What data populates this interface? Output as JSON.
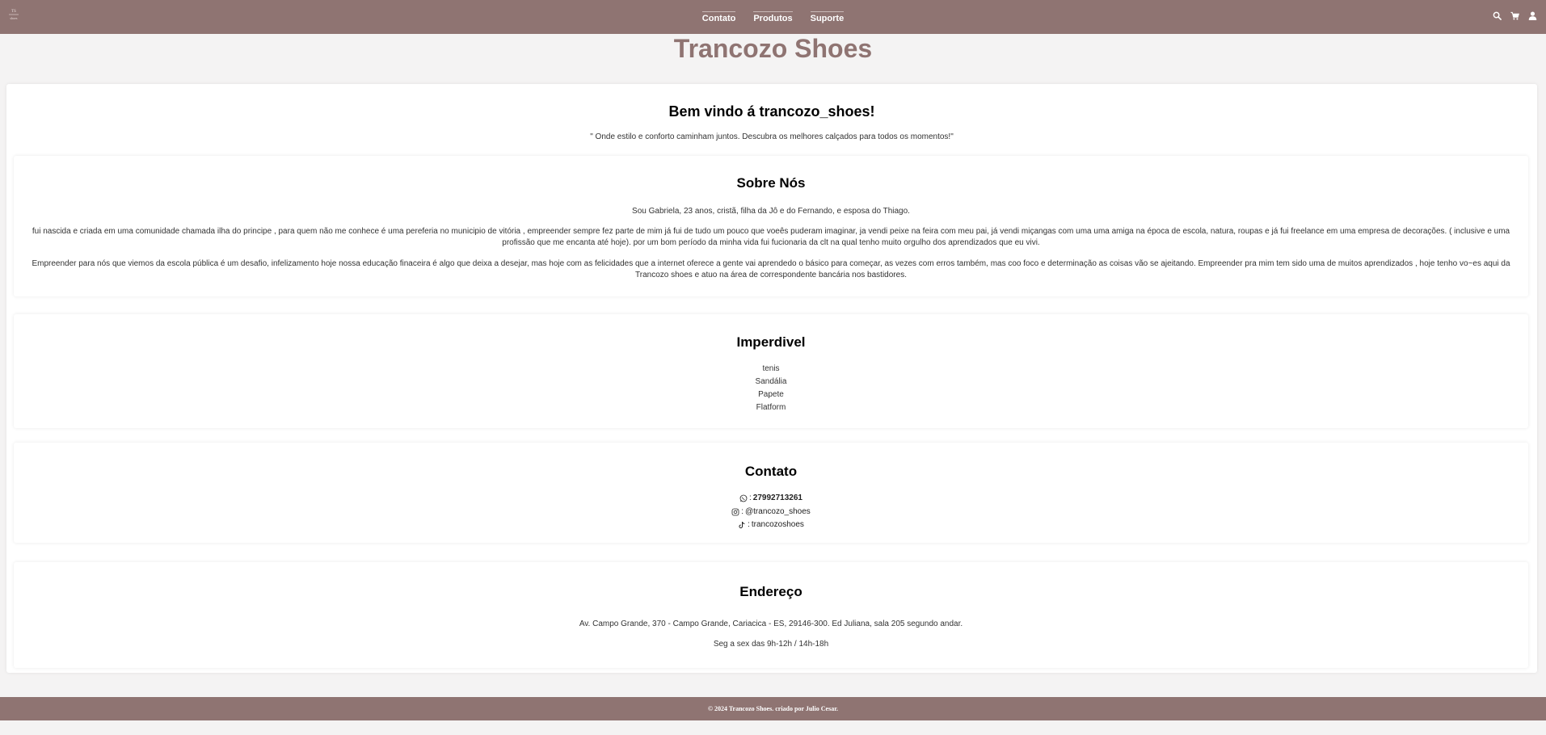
{
  "header": {
    "logo_text": "",
    "nav": [
      {
        "label": "Contato"
      },
      {
        "label": "Produtos"
      },
      {
        "label": "Suporte"
      }
    ],
    "icons": [
      "search-icon",
      "cart-icon",
      "user-icon"
    ]
  },
  "site_title": "Trancozo Shoes",
  "welcome": {
    "title": "Bem vindo á trancozo_shoes!",
    "subtitle": "\" Onde estilo e conforto caminham juntos. Descubra os melhores calçados para todos os momentos!\""
  },
  "about": {
    "title": "Sobre Nós",
    "p1": "Sou Gabriela, 23 anos, cristã, filha da Jô e do Fernando, e esposa do Thiago.",
    "p2": "fui nascida e criada em uma comunidade chamada ilha do principe , para quem não me conhece é uma pereferia no municipio de vitória , empreender sempre fez parte de mim já fui de tudo um pouco que voeês puderam imaginar, ja vendi peixe na feira com meu pai, já vendi miçangas com uma uma amiga na época de escola, natura, roupas e já fui freelance em uma empresa de decorações. ( inclusive e uma profissão que me encanta até hoje). por um bom período da minha vida fui fucionaria da clt na qual tenho muito orgulho dos aprendizados que eu vivi.",
    "p3": "Empreender para nós que viemos da escola pública é um desafio, infelizamento hoje nossa educação finaceira é algo que deixa a desejar, mas hoje com as felicidades que a internet oferece a gente vai aprendedo o básico para começar, as vezes com erros também, mas coo foco e determinação as coisas vão se ajeitando. Empreender pra mim tem sido uma de muitos aprendizados , hoje tenho vo~es aqui da Trancozo shoes e atuo na área de correspondente bancária nos bastidores."
  },
  "featured": {
    "title": "Imperdivel",
    "items": [
      "tenis",
      "Sandália",
      "Papete",
      "Flatform"
    ]
  },
  "contact": {
    "title": "Contato",
    "whatsapp": "27992713261",
    "instagram": "@trancozo_shoes",
    "tiktok": "trancozoshoes",
    "sep": ":"
  },
  "address": {
    "title": "Endereço",
    "line": "Av. Campo Grande, 370 - Campo Grande, Cariacica - ES, 29146-300. Ed Juliana, sala 205 segundo andar.",
    "hours": "Seg a sex das 9h-12h / 14h-18h"
  },
  "footer": {
    "text": "© 2024 Trancozo Shoes. criado por Julio Cesar."
  },
  "colors": {
    "brand": "#8f7472",
    "background": "#f4f3f3"
  }
}
